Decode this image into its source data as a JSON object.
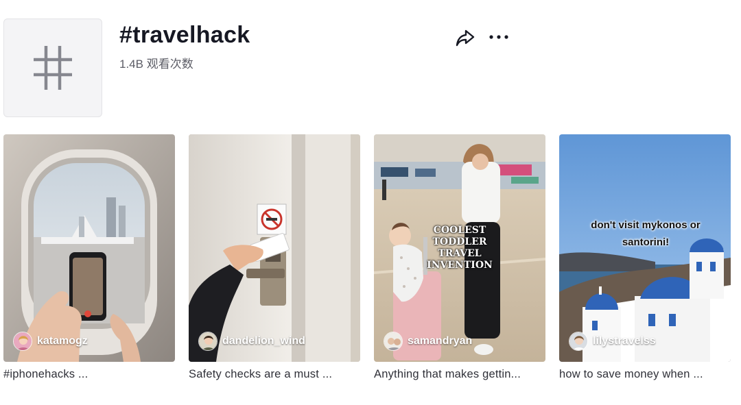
{
  "hashtag": {
    "title": "#travelhack",
    "views": "1.4B 观看次数",
    "icon": "hashtag-icon"
  },
  "actions": {
    "share_icon": "share-arrow-icon",
    "more_icon": "more-dots-icon"
  },
  "videos": [
    {
      "username": "katamogz",
      "caption": "#iphonehacks ...",
      "overlay": ""
    },
    {
      "username": "dandelion_wind",
      "caption": "Safety checks are a must ...",
      "overlay": ""
    },
    {
      "username": "samandryan",
      "caption": "Anything that makes gettin...",
      "overlay": "COOLEST TODDLER TRAVEL INVENTION"
    },
    {
      "username": "lilystravelss",
      "caption": "how to save money when ...",
      "overlay": "don't visit mykonos or santorini!"
    }
  ],
  "colors": {
    "title": "#161823",
    "secondary_text": "#5c5d66",
    "santorini_blue": "#2f64b8"
  }
}
